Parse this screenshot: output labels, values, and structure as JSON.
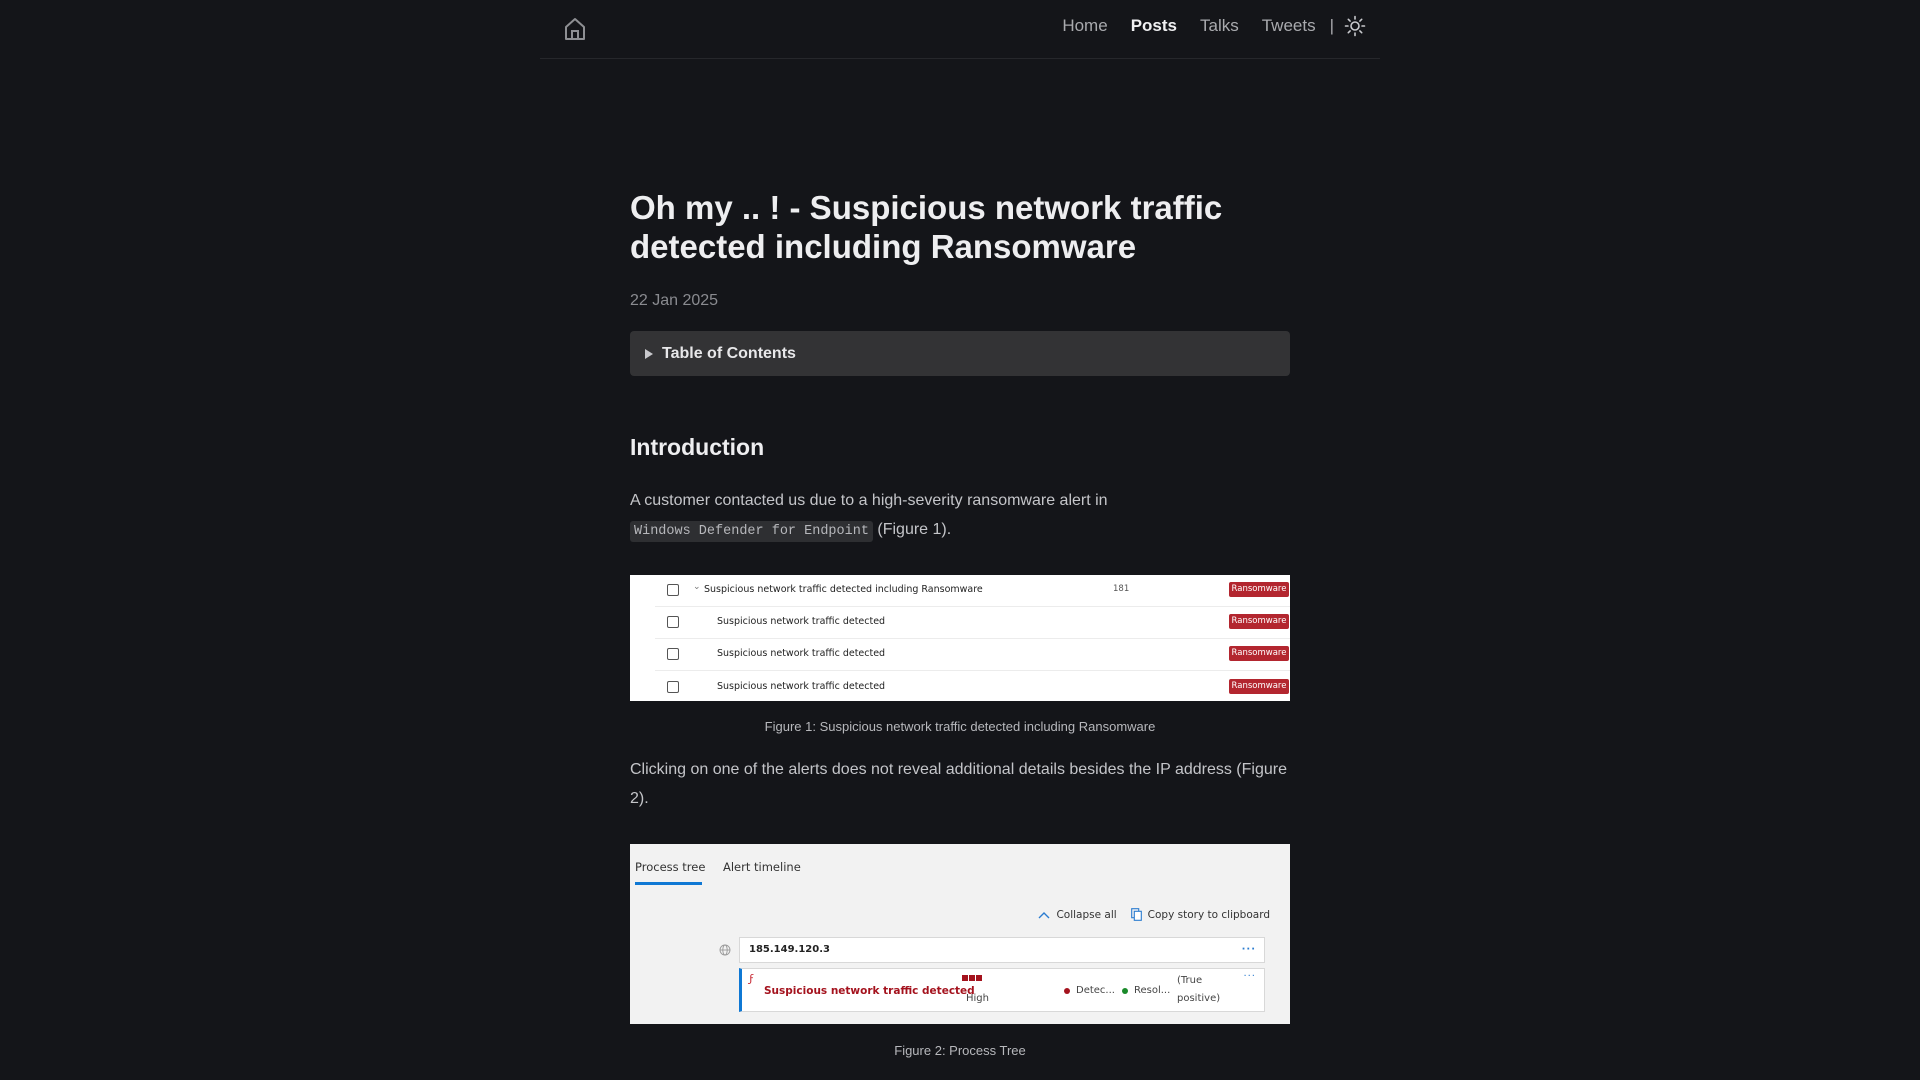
{
  "nav": {
    "home_icon": "home-icon",
    "links": [
      {
        "label": "Home",
        "active": false
      },
      {
        "label": "Posts",
        "active": true
      },
      {
        "label": "Talks",
        "active": false
      },
      {
        "label": "Tweets",
        "active": false
      }
    ],
    "separator": "|",
    "theme_icon": "sun-icon"
  },
  "post": {
    "title": "Oh my .. ! - Suspicious network traffic detected including Ransomware",
    "date": "22 Jan 2025",
    "toc_label": "Table of Contents",
    "section_heading": "Introduction",
    "para1_text": "A customer contacted us due to a high-severity ransomware alert in",
    "para1_code": "Windows Defender for Endpoint",
    "para1_suffix": " (Figure 1).",
    "para2": "Clicking on one of the alerts does not reveal additional details besides the IP address (Figure 2).",
    "figure1_caption": "Figure 1: Suspicious network traffic detected including Ransomware",
    "figure2_caption": "Figure 2: Process Tree"
  },
  "figure1": {
    "rows": [
      {
        "title": "Suspicious network traffic detected including Ransomware",
        "count": "181",
        "tag": "Ransomware",
        "expandable": true
      },
      {
        "title": "Suspicious network traffic detected",
        "count": "",
        "tag": "Ransomware",
        "expandable": false
      },
      {
        "title": "Suspicious network traffic detected",
        "count": "",
        "tag": "Ransomware",
        "expandable": false
      },
      {
        "title": "Suspicious network traffic detected",
        "count": "",
        "tag": "Ransomware",
        "expandable": false
      }
    ],
    "tag_color": "#b3262f"
  },
  "figure2": {
    "tabs": [
      "Process tree",
      "Alert timeline"
    ],
    "active_tab": "Process tree",
    "collapse_all": "Collapse all",
    "copy_story": "Copy story to clipboard",
    "ip": "185.149.120.3",
    "alert_title": "Suspicious network traffic detected",
    "severity": "High",
    "status_detection": "Detec...",
    "status_resolved": "Resol...",
    "classification": "(True positive)",
    "more": "···",
    "colors": {
      "accent": "#0f78d4",
      "alert": "#a4121d",
      "detected_dot": "#a4121d",
      "resolved_dot": "#1a8a2a"
    }
  }
}
